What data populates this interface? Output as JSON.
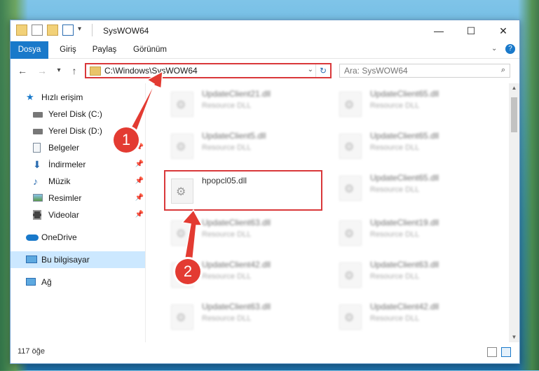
{
  "window": {
    "title": "SysWOW64",
    "controls": {
      "minimize": "—",
      "maximize": "☐",
      "close": "✕"
    }
  },
  "ribbon": {
    "tabs": [
      "Dosya",
      "Giriş",
      "Paylaş",
      "Görünüm"
    ],
    "help_icon": "?"
  },
  "nav": {
    "back": "←",
    "forward": "→",
    "recent": "▾",
    "up": "↑"
  },
  "address": {
    "path": "C:\\Windows\\SysWOW64",
    "dropdown": "⌄",
    "refresh": "↻"
  },
  "search": {
    "placeholder": "Ara: SysWOW64",
    "icon": "⌕"
  },
  "sidebar": {
    "items": [
      {
        "label": "Hızlı erişim",
        "icon": "star-icon"
      },
      {
        "label": "Yerel Disk (C:)",
        "icon": "drive-icon"
      },
      {
        "label": "Yerel Disk (D:)",
        "icon": "drive-icon"
      },
      {
        "label": "Belgeler",
        "icon": "documents-icon",
        "pinned": true
      },
      {
        "label": "İndirmeler",
        "icon": "downloads-icon",
        "pinned": true
      },
      {
        "label": "Müzik",
        "icon": "music-icon",
        "pinned": true
      },
      {
        "label": "Resimler",
        "icon": "pictures-icon",
        "pinned": true
      },
      {
        "label": "Videolar",
        "icon": "videos-icon",
        "pinned": true
      },
      {
        "label": "OneDrive",
        "icon": "cloud-icon"
      },
      {
        "label": "Bu bilgisayar",
        "icon": "computer-icon",
        "selected": true
      },
      {
        "label": "Ağ",
        "icon": "network-icon"
      }
    ],
    "pin_glyph": "📌"
  },
  "files": [
    {
      "name": "UpdateClient21.dll",
      "type": "Resource DLL"
    },
    {
      "name": "UpdateClient65.dll",
      "type": "Resource DLL"
    },
    {
      "name": "UpdateClient5.dll",
      "type": "Resource DLL"
    },
    {
      "name": "UpdateClient65.dll",
      "type": "Resource DLL"
    },
    {
      "name": "hpopcl05.dll",
      "type": ""
    },
    {
      "name": "UpdateClient65.dll",
      "type": "Resource DLL"
    },
    {
      "name": "UpdateClient63.dll",
      "type": "Resource DLL"
    },
    {
      "name": "UpdateClient19.dll",
      "type": "Resource DLL"
    },
    {
      "name": "UpdateClient42.dll",
      "type": "Resource DLL"
    },
    {
      "name": "UpdateClient63.dll",
      "type": "Resource DLL"
    },
    {
      "name": "UpdateClient63.dll",
      "type": "Resource DLL"
    },
    {
      "name": "UpdateClient42.dll",
      "type": "Resource DLL"
    }
  ],
  "status": {
    "count": "117 öğe"
  },
  "callouts": {
    "one": "1",
    "two": "2"
  },
  "colors": {
    "accent": "#1979ca",
    "highlight": "#d9383a",
    "selected": "#cce8ff"
  }
}
